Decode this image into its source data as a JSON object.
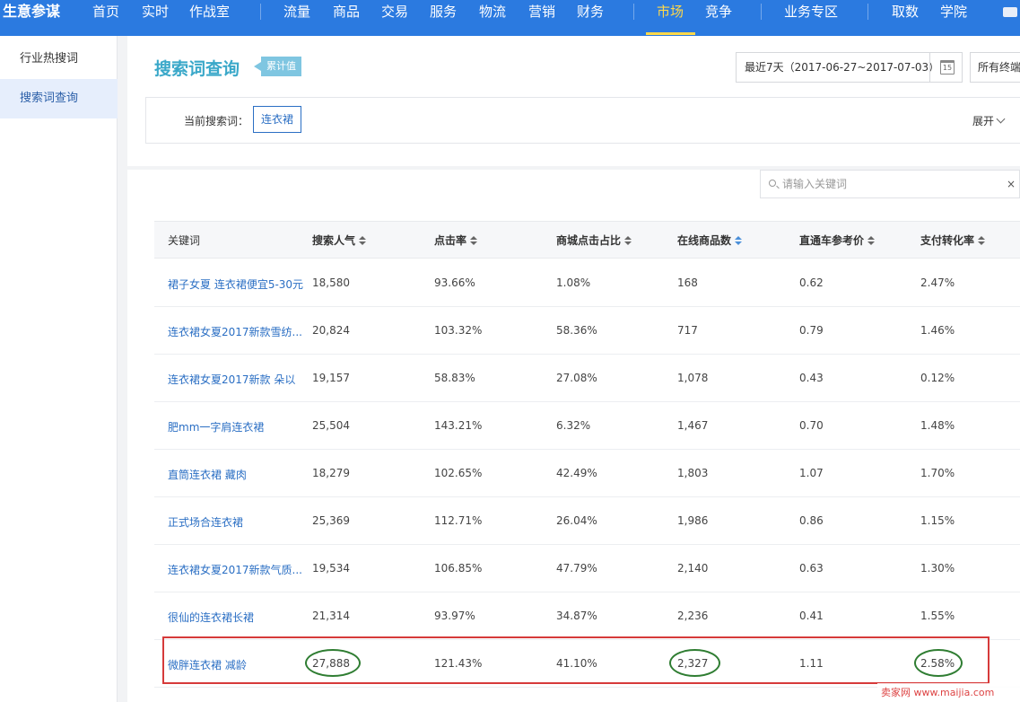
{
  "topnav": {
    "brand": "生意参谋",
    "items": [
      "首页",
      "实时",
      "作战室",
      "流量",
      "商品",
      "交易",
      "服务",
      "物流",
      "营销",
      "财务",
      "市场",
      "竞争",
      "业务专区",
      "取数",
      "学院"
    ],
    "active": "市场"
  },
  "sidebar": {
    "items": [
      {
        "label": "行业热搜词"
      },
      {
        "label": "搜索词查询"
      }
    ],
    "active_index": 1
  },
  "header": {
    "title": "搜索词查询",
    "badge": "累计值",
    "date_range": "最近7天（2017-06-27~2017-07-03）",
    "calendar_icon_text": "15",
    "terminal": "所有终端",
    "current_keyword_label": "当前搜索词：",
    "current_keyword": "连衣裙",
    "expand_label": "展开"
  },
  "search": {
    "placeholder": "请输入关键词",
    "clear": "×"
  },
  "table": {
    "columns": [
      "关键词",
      "搜索人气",
      "点击率",
      "商城点击占比",
      "在线商品数",
      "直通车参考价",
      "支付转化率"
    ],
    "sorted_column": "在线商品数",
    "rows": [
      [
        "裙子女夏 连衣裙便宜5-30元",
        "18,580",
        "93.66%",
        "1.08%",
        "168",
        "0.62",
        "2.47%"
      ],
      [
        "连衣裙女夏2017新款雪纺...",
        "20,824",
        "103.32%",
        "58.36%",
        "717",
        "0.79",
        "1.46%"
      ],
      [
        "连衣裙女夏2017新款 朵以",
        "19,157",
        "58.83%",
        "27.08%",
        "1,078",
        "0.43",
        "0.12%"
      ],
      [
        "肥mm一字肩连衣裙",
        "25,504",
        "143.21%",
        "6.32%",
        "1,467",
        "0.70",
        "1.48%"
      ],
      [
        "直筒连衣裙 藏肉",
        "18,279",
        "102.65%",
        "42.49%",
        "1,803",
        "1.07",
        "1.70%"
      ],
      [
        "正式场合连衣裙",
        "25,369",
        "112.71%",
        "26.04%",
        "1,986",
        "0.86",
        "1.15%"
      ],
      [
        "连衣裙女夏2017新款气质...",
        "19,534",
        "106.85%",
        "47.79%",
        "2,140",
        "0.63",
        "1.30%"
      ],
      [
        "很仙的连衣裙长裙",
        "21,314",
        "93.97%",
        "34.87%",
        "2,236",
        "0.41",
        "1.55%"
      ],
      [
        "微胖连衣裙 减龄",
        "27,888",
        "121.43%",
        "41.10%",
        "2,327",
        "1.11",
        "2.58%"
      ]
    ]
  },
  "watermark": "卖家网 www.maijia.com",
  "colors": {
    "nav_bg": "#2b7ae0",
    "title": "#3aa8c9",
    "link": "#2b6fc4",
    "highlight_border": "#d63a3a",
    "circle": "#2f7d32"
  }
}
